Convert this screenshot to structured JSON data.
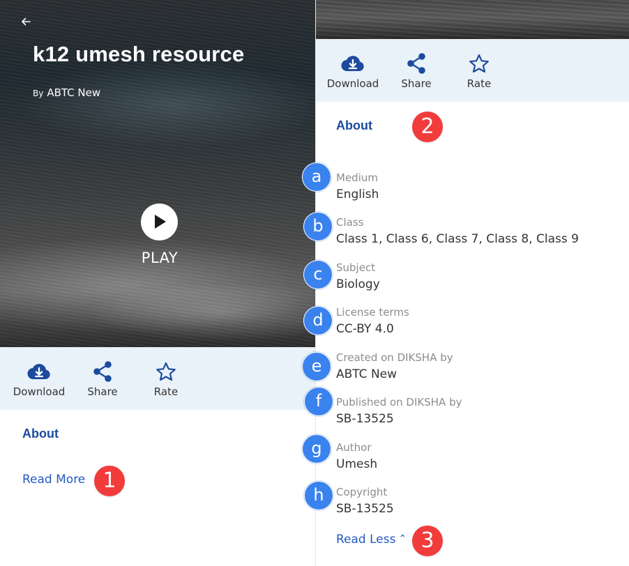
{
  "left_panel": {
    "title": "k12 umesh resource",
    "by_label": "By",
    "author": "ABTC New",
    "play_label": "PLAY",
    "actions": [
      {
        "label": "Download",
        "icon": "cloud-download-icon"
      },
      {
        "label": "Share",
        "icon": "share-icon"
      },
      {
        "label": "Rate",
        "icon": "star-outline-icon"
      }
    ],
    "about_heading": "About",
    "read_more": "Read More"
  },
  "right_panel": {
    "actions": [
      {
        "label": "Download",
        "icon": "cloud-download-icon"
      },
      {
        "label": "Share",
        "icon": "share-icon"
      },
      {
        "label": "Rate",
        "icon": "star-outline-icon"
      }
    ],
    "about_heading": "About",
    "fields": [
      {
        "label": "Medium",
        "value": "English"
      },
      {
        "label": "Class",
        "value": "Class 1, Class 6, Class 7, Class 8, Class 9"
      },
      {
        "label": "Subject",
        "value": "Biology"
      },
      {
        "label": "License terms",
        "value": "CC-BY 4.0"
      },
      {
        "label": "Created on DIKSHA by",
        "value": "ABTC New"
      },
      {
        "label": "Published on DIKSHA by",
        "value": "SB-13525"
      },
      {
        "label": "Author",
        "value": "Umesh"
      },
      {
        "label": "Copyright",
        "value": "SB-13525"
      }
    ],
    "read_less": "Read Less"
  },
  "annotations": {
    "numbered": [
      "1",
      "2",
      "3"
    ],
    "lettered": [
      "a",
      "b",
      "c",
      "d",
      "e",
      "f",
      "g",
      "h"
    ]
  },
  "colors": {
    "accent_blue": "#1c4a9c",
    "link_blue": "#2358c2",
    "action_bar_bg": "#eaf2f9",
    "badge_red": "#f23b3b",
    "badge_blue": "#3a82ee"
  }
}
